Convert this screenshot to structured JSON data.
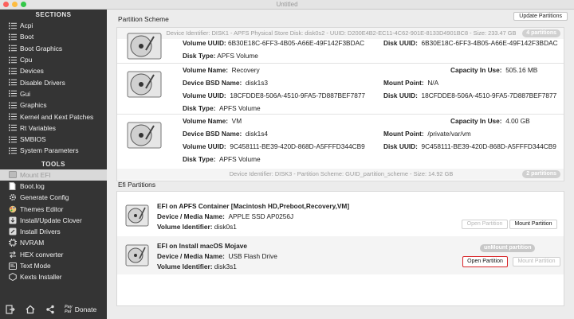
{
  "window": {
    "title": "Untitled"
  },
  "sidebar": {
    "sections_header": "SECTIONS",
    "sections": [
      {
        "label": "Acpi"
      },
      {
        "label": "Boot"
      },
      {
        "label": "Boot Graphics"
      },
      {
        "label": "Cpu"
      },
      {
        "label": "Devices"
      },
      {
        "label": "Disable Drivers"
      },
      {
        "label": "Gui"
      },
      {
        "label": "Graphics"
      },
      {
        "label": "Kernel and Kext Patches"
      },
      {
        "label": "Rt Variables"
      },
      {
        "label": "SMBIOS"
      },
      {
        "label": "System Parameters"
      }
    ],
    "tools_header": "TOOLS",
    "tools": [
      {
        "label": "Mount EFI",
        "icon": "drive-icon"
      },
      {
        "label": "Boot.log",
        "icon": "document-icon"
      },
      {
        "label": "Generate Config",
        "icon": "gear-icon"
      },
      {
        "label": "Themes Editor",
        "icon": "palette-icon"
      },
      {
        "label": "Install/Update Clover",
        "icon": "download-icon"
      },
      {
        "label": "Install Drivers",
        "icon": "driver-icon"
      },
      {
        "label": "NVRAM",
        "icon": "chip-icon"
      },
      {
        "label": "HEX converter",
        "icon": "converter-icon"
      },
      {
        "label": "Text Mode",
        "icon": "text-icon"
      },
      {
        "label": "Kexts Installer",
        "icon": "kext-icon"
      }
    ],
    "bottom": {
      "paypal_line1": "Pay",
      "paypal_line2": "Pal",
      "donate_label": "Donate"
    }
  },
  "partition_scheme": {
    "title": "Partition Scheme",
    "update_button": "Update Partitions",
    "disk1": {
      "bar_text": "Device Identifier: DISK1 - APFS Physical Store Disk: disk0s2 - UUID: D200E4B2-EC11-4C62-901E-8133D4901BC8 - Size: 233.47 GB",
      "badge": "4 partitions"
    },
    "volumes": [
      {
        "partial": true,
        "uuid_label": "Volume UUID:",
        "uuid": "6B30E18C-6FF3-4B05-A66E-49F142F3BDAC",
        "disk_uuid_label": "Disk UUID:",
        "disk_uuid": "6B30E18C-6FF3-4B05-A66E-49F142F3BDAC",
        "type_label": "Disk Type:",
        "type": "APFS Volume"
      },
      {
        "name_label": "Volume Name:",
        "name": "Recovery",
        "capacity_label": "Capacity In Use:",
        "capacity": "505.16 MB",
        "bsd_label": "Device BSD Name:",
        "bsd": "disk1s3",
        "mount_label": "Mount Point:",
        "mount": "N/A",
        "uuid_label": "Volume UUID:",
        "uuid": "18CFDDE8-506A-4510-9FA5-7D887BEF7877",
        "disk_uuid_label": "Disk UUID:",
        "disk_uuid": "18CFDDE8-506A-4510-9FA5-7D887BEF7877",
        "type_label": "Disk Type:",
        "type": "APFS Volume"
      },
      {
        "name_label": "Volume Name:",
        "name": "VM",
        "capacity_label": "Capacity In Use:",
        "capacity": "4.00 GB",
        "bsd_label": "Device BSD Name:",
        "bsd": "disk1s4",
        "mount_label": "Mount Point:",
        "mount": "/private/var/vm",
        "uuid_label": "Volume UUID:",
        "uuid": "9C458111-BE39-420D-868D-A5FFFD344CB9",
        "disk_uuid_label": "Disk UUID:",
        "disk_uuid": "9C458111-BE39-420D-868D-A5FFFD344CB9",
        "type_label": "Disk Type:",
        "type": "APFS Volume"
      }
    ],
    "disk3": {
      "bar_text": "Device Identifier: DISK3 - Partition Scheme: GUID_partition_scheme - Size: 14.92 GB",
      "badge": "2 partitions"
    }
  },
  "efi_partitions": {
    "title": "Efi Partitions",
    "items": [
      {
        "title": "EFI on APFS Container [Macintosh HD,Preboot,Recovery,VM]",
        "media_label": "Device / Media Name:",
        "media": "APPLE SSD AP0256J",
        "id_label": "Volume Identifier:",
        "id": "disk0s1",
        "open_label": "Open Partition",
        "mount_label": "Mount Partition"
      },
      {
        "title": "EFI on Install macOS Mojave",
        "media_label": "Device / Media Name:",
        "media": "USB Flash Drive",
        "id_label": "Volume Identifier:",
        "id": "disk3s1",
        "status_badge": "unMount partition",
        "open_label": "Open Partition",
        "mount_label": "Mount Partition"
      }
    ]
  },
  "colors": {
    "sidebar_bg": "#343434",
    "highlight_border": "#d8262a",
    "badge_bg": "#d0d0d0"
  }
}
